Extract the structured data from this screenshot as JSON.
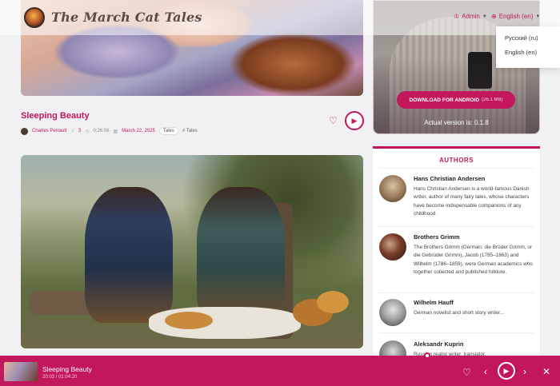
{
  "header": {
    "title": "The March Cat Tales",
    "admin_label": "Admin",
    "language_label": "English (en)",
    "language_options": [
      "Русский (ru)",
      "English (en)"
    ]
  },
  "story": {
    "title": "Sleeping Beauty",
    "author": "Charles Perrault",
    "listens": "3",
    "duration": "0:26:06",
    "date": "March 22, 2025",
    "category": "Tales",
    "tag": "# Tales"
  },
  "promo": {
    "download_label": "DOWNLOAD FOR ANDROID",
    "download_size": "(26.1 MB)",
    "version": "Actual version is: 0.1.8"
  },
  "authors": {
    "title": "AUTHORS",
    "items": [
      {
        "name": "Hans Christian Andersen",
        "desc": "Hans Christian Andersen is a world-famous Danish writer, author of many fairy tales, whose characters have become indispensable companions of any childhood."
      },
      {
        "name": "Brothers Grimm",
        "desc": "The Brothers Grimm (German: die Brüder Grimm, or die Gebrüder Grimm), Jacob (1785–1863) and Wilhelm (1786–1859), were German academics who together collected and published folklore."
      },
      {
        "name": "Wilhelm Hauff",
        "desc": "German novelist and short story writer..."
      },
      {
        "name": "Aleksandr Kuprin",
        "desc": "Russian realist writer, translator."
      }
    ]
  },
  "player": {
    "title": "Sleeping Beauty",
    "time": "20:03 / 01:04:20"
  },
  "colors": {
    "accent": "#c2185b"
  }
}
